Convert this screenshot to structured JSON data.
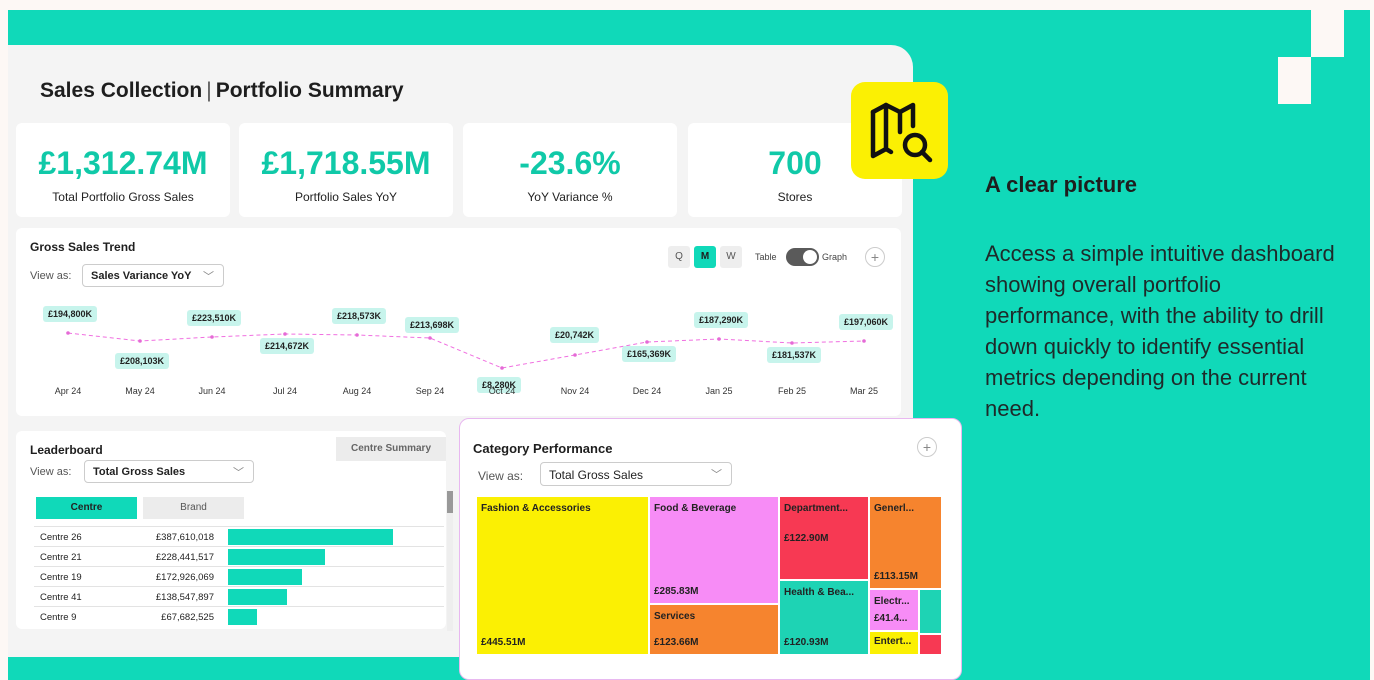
{
  "colors": {
    "accent": "#10d9b9",
    "yellow": "#fbf003",
    "pink": "#f78cf6",
    "red": "#f73953",
    "orange": "#f6842e",
    "teal_tile": "#1ed3b4"
  },
  "header": {
    "title_left": "Sales Collection",
    "title_sep": "|",
    "title_right": "Portfolio Summary"
  },
  "kpis": [
    {
      "value": "£1,312.74M",
      "label": "Total Portfolio Gross Sales"
    },
    {
      "value": "£1,718.55M",
      "label": "Portfolio Sales YoY"
    },
    {
      "value": "-23.6%",
      "label": "YoY Variance %"
    },
    {
      "value": "700",
      "label": "Stores"
    }
  ],
  "trend": {
    "title": "Gross Sales Trend",
    "view_as": "View as:",
    "select": "Sales Variance YoY",
    "periods": [
      "Q",
      "M",
      "W"
    ],
    "active_period": "M",
    "toggle_left": "Table",
    "toggle_right": "Graph",
    "plus": "+",
    "points": [
      {
        "month": "Apr 24",
        "label": "£194,800K"
      },
      {
        "month": "May 24",
        "label": "£208,103K"
      },
      {
        "month": "Jun 24",
        "label": "£223,510K"
      },
      {
        "month": "Jul 24",
        "label": "£214,672K"
      },
      {
        "month": "Aug 24",
        "label": "£218,573K"
      },
      {
        "month": "Sep 24",
        "label": "£213,698K"
      },
      {
        "month": "Oct 24",
        "label": "£8,280K"
      },
      {
        "month": "Nov 24",
        "label": "£20,742K"
      },
      {
        "month": "Dec 24",
        "label": "£165,369K"
      },
      {
        "month": "Jan 25",
        "label": "£187,290K"
      },
      {
        "month": "Feb 25",
        "label": "£181,537K"
      },
      {
        "month": "Mar 25",
        "label": "£197,060K"
      }
    ]
  },
  "leaderboard": {
    "title": "Leaderboard",
    "centre_summary": "Centre Summary",
    "view_as": "View as:",
    "select": "Total Gross Sales",
    "tabs": [
      "Centre",
      "Brand"
    ],
    "rows": [
      {
        "name": "Centre 26",
        "amount": "£387,610,018",
        "value": 387610018
      },
      {
        "name": "Centre 21",
        "amount": "£228,441,517",
        "value": 228441517
      },
      {
        "name": "Centre 19",
        "amount": "£172,926,069",
        "value": 172926069
      },
      {
        "name": "Centre 41",
        "amount": "£138,547,897",
        "value": 138547897
      },
      {
        "name": "Centre 9",
        "amount": "£67,682,525",
        "value": 67682525
      }
    ]
  },
  "category": {
    "title": "Category Performance",
    "view_as": "View as:",
    "select": "Total Gross Sales",
    "plus": "+",
    "tiles": {
      "fashion": {
        "name": "Fashion & Accessories",
        "value": "£445.51M"
      },
      "food": {
        "name": "Food & Beverage",
        "value": "£285.83M"
      },
      "services": {
        "name": "Services",
        "value": "£123.66M"
      },
      "department": {
        "name": "Department...",
        "value": "£122.90M"
      },
      "health": {
        "name": "Health & Bea...",
        "value": "£120.93M"
      },
      "general": {
        "name": "Generl...",
        "value": "£113.15M"
      },
      "electronics": {
        "name": "Electr...",
        "value": "£41.4..."
      },
      "entertainment": {
        "name": "Entert...",
        "value": ""
      }
    }
  },
  "side": {
    "heading": "A clear picture",
    "body": "Access a simple intuitive dashboard showing overall portfolio performance, with the ability to drill down quickly to identify essential metrics depending on the current need."
  },
  "icons": {
    "badge": "map-search-icon"
  }
}
